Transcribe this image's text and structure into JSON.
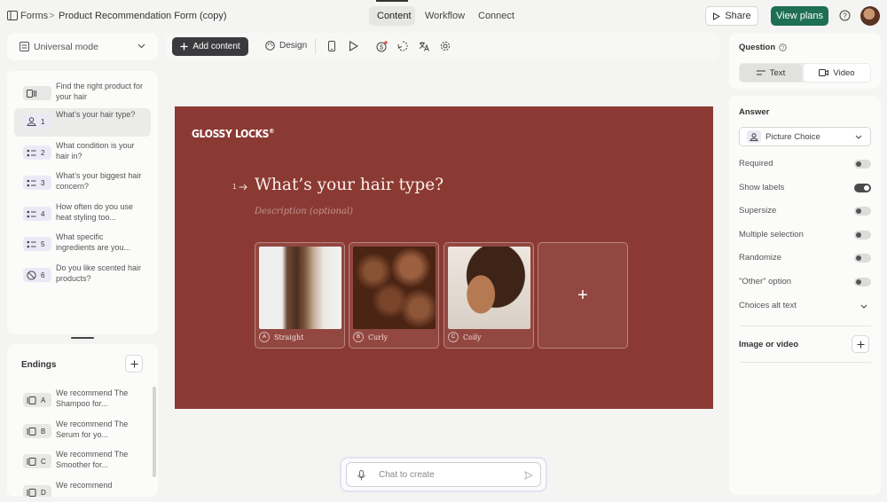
{
  "topbar": {
    "breadcrumb_root": "Forms",
    "breadcrumb_sep": ">",
    "form_title": "Product Recommendation Form (copy)",
    "tabs": [
      {
        "label": "Content"
      },
      {
        "label": "Workflow"
      },
      {
        "label": "Connect"
      }
    ],
    "share_label": "Share",
    "plans_label": "View plans"
  },
  "left": {
    "mode_label": "Universal mode",
    "questions": [
      {
        "num": "",
        "text": "Find the right product for your hair",
        "icon": "welcome-screen-icon"
      },
      {
        "num": "1",
        "text": "What’s your hair type?",
        "icon": "picture-choice-icon"
      },
      {
        "num": "2",
        "text": "What condition is your hair in?",
        "icon": "multiple-choice-icon"
      },
      {
        "num": "3",
        "text": "What’s your biggest hair concern?",
        "icon": "multiple-choice-icon"
      },
      {
        "num": "4",
        "text": "How often do you use heat styling too...",
        "icon": "multiple-choice-icon"
      },
      {
        "num": "5",
        "text": "What specific ingredients are you...",
        "icon": "multiple-choice-icon"
      },
      {
        "num": "6",
        "text": "Do you like scented hair products?",
        "icon": "yes-no-icon"
      }
    ],
    "endings_title": "Endings",
    "endings": [
      {
        "key": "A",
        "text": "We recommend The Shampoo for..."
      },
      {
        "key": "B",
        "text": "We recommend The Serum for yo..."
      },
      {
        "key": "C",
        "text": "We recommend The Smoother for..."
      },
      {
        "key": "D",
        "text": "We recommend"
      }
    ]
  },
  "toolbar": {
    "add_label": "Add content",
    "design_label": "Design"
  },
  "canvas": {
    "brand": "GLOSSY LOCKS",
    "brand_mark": "®",
    "question_number": "1",
    "question": "What’s your hair type?",
    "description_placeholder": "Description (optional)",
    "choices": [
      {
        "key": "A",
        "label": "Straight"
      },
      {
        "key": "B",
        "label": "Curly"
      },
      {
        "key": "C",
        "label": "Coily"
      }
    ],
    "add_choice_symbol": "+",
    "bg_color": "#8b3a33"
  },
  "chat": {
    "placeholder": "Chat to create"
  },
  "right": {
    "question_title": "Question",
    "question_tabs": [
      {
        "label": "Text"
      },
      {
        "label": "Video"
      }
    ],
    "answer_title": "Answer",
    "answer_type": "Picture Choice",
    "settings": [
      {
        "label": "Required",
        "on": false
      },
      {
        "label": "Show labels",
        "on": true
      },
      {
        "label": "Supersize",
        "on": false
      },
      {
        "label": "Multiple selection",
        "on": false
      },
      {
        "label": "Randomize",
        "on": false
      },
      {
        "label": "\"Other\" option",
        "on": false
      }
    ],
    "alt_text_label": "Choices alt text",
    "image_video_label": "Image or video"
  },
  "colors": {
    "accent_green": "#1f6f55",
    "dark_button": "#3b3a3d",
    "canvas_brick": "#8b3a33"
  }
}
